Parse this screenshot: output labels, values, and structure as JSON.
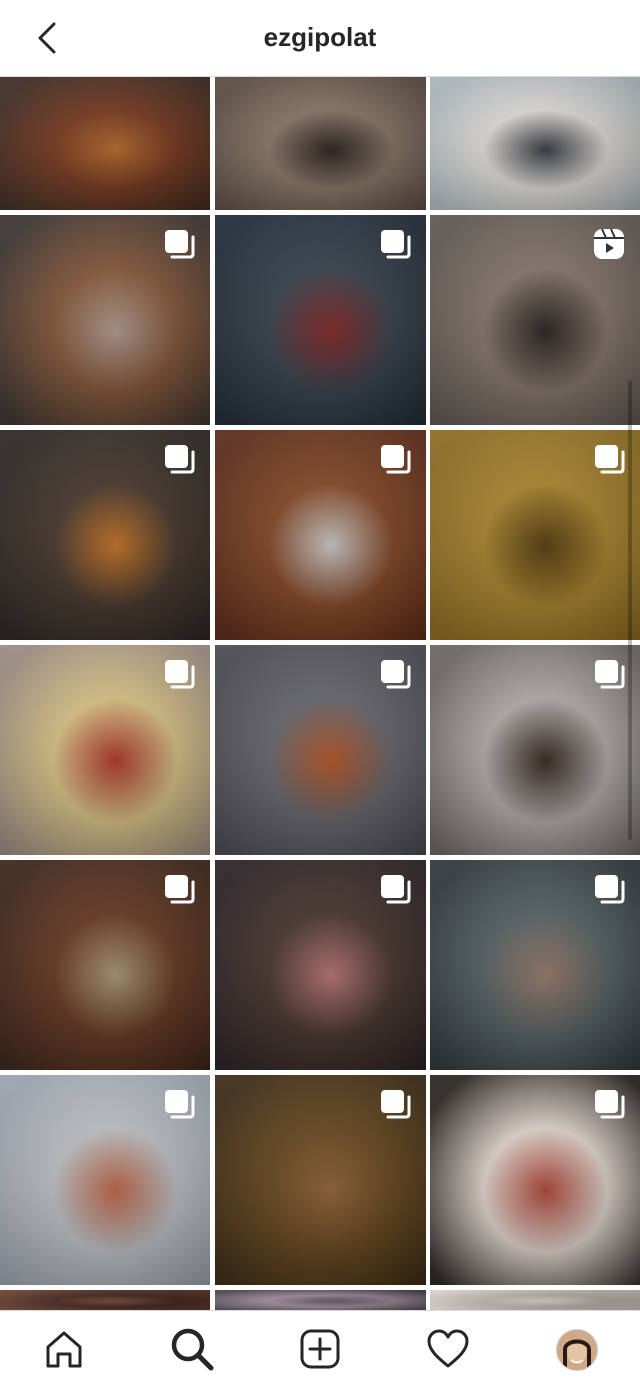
{
  "header": {
    "username": "ezgipolat",
    "back_icon": "chevron-left-icon"
  },
  "grid": {
    "tiles": [
      {
        "name": "post-tile-1-1",
        "badge": "none",
        "colors": [
          "#3b2a22",
          "#7a3b21",
          "#c2702f"
        ]
      },
      {
        "name": "post-tile-1-2",
        "badge": "none",
        "colors": [
          "#5a4a40",
          "#8d7a6a",
          "#2e2420"
        ]
      },
      {
        "name": "post-tile-1-3",
        "badge": "none",
        "colors": [
          "#a9b5b9",
          "#e8e4df",
          "#3a3f45"
        ]
      },
      {
        "name": "post-tile-2-1",
        "badge": "carousel",
        "colors": [
          "#3a3330",
          "#8a5a3c",
          "#bba294"
        ]
      },
      {
        "name": "post-tile-2-2",
        "badge": "carousel",
        "colors": [
          "#1f2a35",
          "#3a4450",
          "#8a2a2a"
        ]
      },
      {
        "name": "post-tile-2-3",
        "badge": "reel",
        "colors": [
          "#5d5550",
          "#8a7a70",
          "#2c2420"
        ]
      },
      {
        "name": "post-tile-3-1",
        "badge": "carousel",
        "colors": [
          "#2a2522",
          "#4a3a30",
          "#d27a28"
        ]
      },
      {
        "name": "post-tile-3-2",
        "badge": "carousel",
        "colors": [
          "#5a2a18",
          "#8a4a28",
          "#d8d4d2"
        ]
      },
      {
        "name": "post-tile-3-3",
        "badge": "carousel",
        "colors": [
          "#8a6a20",
          "#b08a30",
          "#5a4010"
        ]
      },
      {
        "name": "post-tile-4-1",
        "badge": "carousel",
        "colors": [
          "#9a8a80",
          "#e0c98a",
          "#b83a28"
        ]
      },
      {
        "name": "post-tile-4-2",
        "badge": "carousel",
        "colors": [
          "#4a4850",
          "#6a6a72",
          "#c05a2a"
        ]
      },
      {
        "name": "post-tile-4-3",
        "badge": "carousel",
        "colors": [
          "#6a6460",
          "#b6b2ae",
          "#3a2a22"
        ]
      },
      {
        "name": "post-tile-5-1",
        "badge": "carousel",
        "colors": [
          "#3a2418",
          "#6a3a24",
          "#b4a07a"
        ]
      },
      {
        "name": "post-tile-5-2",
        "badge": "carousel",
        "colors": [
          "#2a2024",
          "#4a3830",
          "#c27a7a"
        ]
      },
      {
        "name": "post-tile-5-3",
        "badge": "carousel",
        "colors": [
          "#2e3638",
          "#5a6668",
          "#a08070"
        ]
      },
      {
        "name": "post-tile-6-1",
        "badge": "carousel",
        "colors": [
          "#9aa2ac",
          "#c4c8cc",
          "#c86a4a"
        ]
      },
      {
        "name": "post-tile-6-2",
        "badge": "carousel",
        "colors": [
          "#3a2a14",
          "#6a4a20",
          "#9a6a3a"
        ]
      },
      {
        "name": "post-tile-6-3",
        "badge": "carousel",
        "colors": [
          "#2a2420",
          "#e8dcd4",
          "#b84a3a"
        ]
      },
      {
        "name": "post-tile-7-1",
        "badge": "none",
        "colors": [
          "#6a4030",
          "#4a2a20",
          "#7a5040"
        ]
      },
      {
        "name": "post-tile-7-2",
        "badge": "none",
        "colors": [
          "#4a4650",
          "#a890a0",
          "#6a6070"
        ]
      },
      {
        "name": "post-tile-7-3",
        "badge": "none",
        "colors": [
          "#d8d0c8",
          "#c0b8b0",
          "#e4dcd4"
        ]
      }
    ]
  },
  "bottom_nav": {
    "items": [
      {
        "name": "home-icon"
      },
      {
        "name": "search-icon"
      },
      {
        "name": "new-post-icon"
      },
      {
        "name": "activity-heart-icon"
      },
      {
        "name": "profile-avatar"
      }
    ]
  }
}
